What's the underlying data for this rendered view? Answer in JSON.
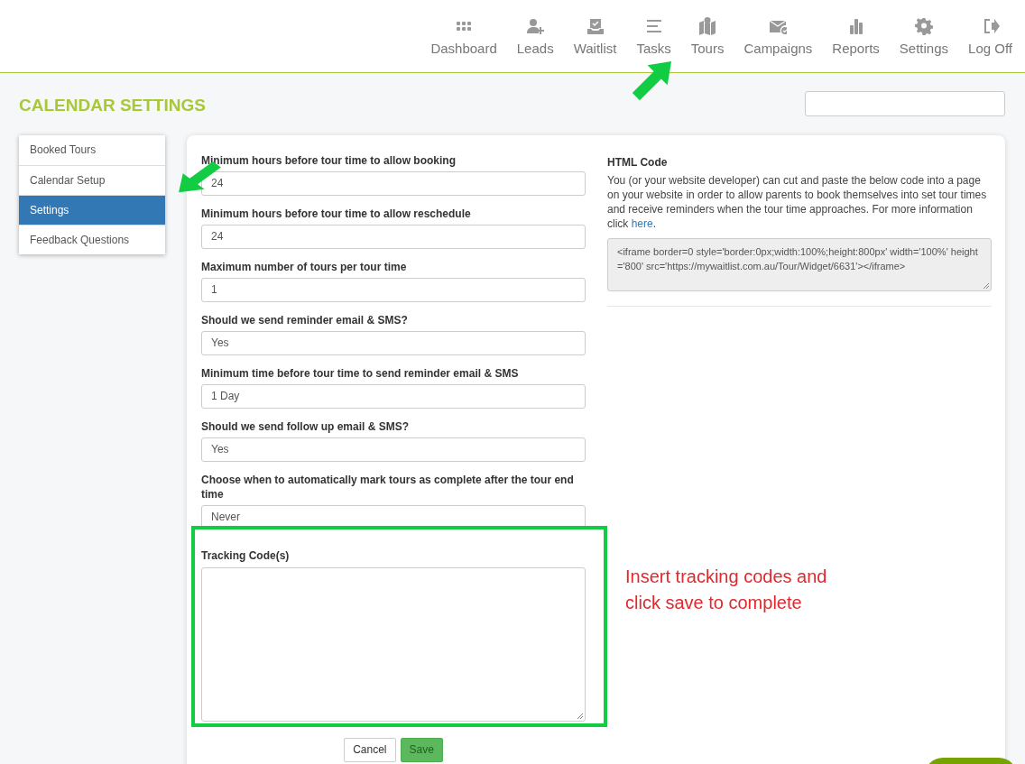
{
  "nav": [
    {
      "label": "Dashboard"
    },
    {
      "label": "Leads"
    },
    {
      "label": "Waitlist"
    },
    {
      "label": "Tasks"
    },
    {
      "label": "Tours"
    },
    {
      "label": "Campaigns"
    },
    {
      "label": "Reports"
    },
    {
      "label": "Settings"
    },
    {
      "label": "Log Off"
    }
  ],
  "page_title": "CALENDAR SETTINGS",
  "sidebar": {
    "items": [
      {
        "label": "Booked Tours",
        "selected": false
      },
      {
        "label": "Calendar Setup",
        "selected": false
      },
      {
        "label": "Settings",
        "selected": true
      },
      {
        "label": "Feedback Questions",
        "selected": false
      }
    ]
  },
  "form": {
    "fields": [
      {
        "label": "Minimum hours before tour time to allow booking",
        "value": "24"
      },
      {
        "label": "Minimum hours before tour time to allow reschedule",
        "value": "24"
      },
      {
        "label": "Maximum number of tours per tour time",
        "value": "1"
      },
      {
        "label": "Should we send reminder email & SMS?",
        "value": "Yes"
      },
      {
        "label": "Minimum time before tour time to send reminder email & SMS",
        "value": "1 Day"
      },
      {
        "label": "Should we send follow up email & SMS?",
        "value": "Yes"
      },
      {
        "label": "Choose when to automatically mark tours as complete after the tour end time",
        "value": "Never"
      }
    ],
    "tracking": {
      "label": "Tracking Code(s)"
    },
    "buttons": [
      {
        "label": "Cancel",
        "kind": "cancel"
      },
      {
        "label": "Save",
        "kind": "save"
      }
    ]
  },
  "html_code": {
    "title": "HTML Code",
    "text": "You (or your website developer) can cut and paste the below code into a page on your website in order to allow parents to book themselves into set tour times and receive reminders when the tour time approaches. For more information click ",
    "link": "here",
    "text_end": ".",
    "code": "<iframe border=0 style='border:0px;width:100%;height:800px' width='100%' height='800' src='https://mywaitlist.com.au/Tour/Widget/6631'></iframe>"
  },
  "annotation": {
    "note": "Insert tracking codes and click save to complete"
  }
}
